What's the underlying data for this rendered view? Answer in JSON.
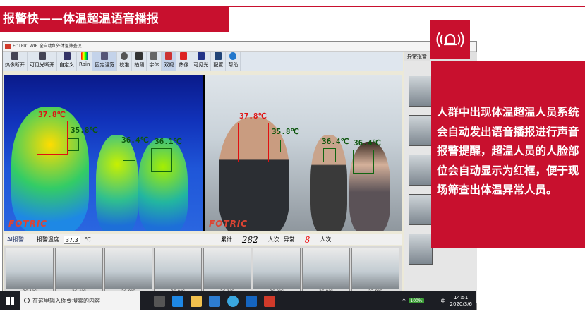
{
  "slide": {
    "title": "报警快——体温超温语音播报",
    "description": "人群中出现体温超温人员系统会自动发出语音播报进行声音报警提醒，超温人员的人脸部位会自动显示为红框，便于现场筛查出体温异常人员。",
    "accent_color": "#c8102e",
    "icon": "alarm-bell-icon"
  },
  "app": {
    "window_title": "FOTRIC WIR 全自动红外体温筛查仪",
    "toolbar": [
      {
        "label": "热像断开",
        "icon": "thermal-disconnect-icon"
      },
      {
        "label": "可见光断开",
        "icon": "visible-disconnect-icon"
      },
      {
        "label": "自定义",
        "icon": "anchor-icon"
      },
      {
        "label": "Rain",
        "icon": "palette-icon"
      },
      {
        "label": "固定温宽",
        "icon": "fixed-span-icon"
      },
      {
        "label": "校准",
        "icon": "gear-icon"
      },
      {
        "label": "拍照",
        "icon": "camera-icon"
      },
      {
        "label": "字体",
        "icon": "font-icon"
      },
      {
        "label": "双视",
        "icon": "dual-view-icon"
      },
      {
        "label": "热像",
        "icon": "thermal-icon"
      },
      {
        "label": "可见光",
        "icon": "visible-icon"
      },
      {
        "label": "配置",
        "icon": "monitor-icon"
      },
      {
        "label": "帮助",
        "icon": "help-icon"
      }
    ],
    "side_panel_title": "异常报警",
    "thermal_brand": "FOTRIC",
    "visible_brand": "FOTRIC",
    "thermal_readings": [
      "37.8℃",
      "35.8℃",
      "36.4℃",
      "36.1℃"
    ],
    "visible_readings": [
      "37.8℃",
      "35.8℃",
      "36.4℃",
      "36.4℃"
    ],
    "status": {
      "ai_label": "AI报警",
      "alarm_temp_label": "报警温度",
      "alarm_temp_value": "37.3",
      "alarm_temp_unit": "℃",
      "total_label": "累计",
      "total_value": "282",
      "total_unit": "人次",
      "abnormal_label": "异常",
      "abnormal_value": "8",
      "abnormal_unit": "人次"
    },
    "thumb_temps": [
      "36.1℃",
      "36.4℃",
      "36.0℃",
      "36.0℃",
      "36.1℃",
      "36.2℃",
      "36.0℃",
      "37.8℃"
    ]
  },
  "taskbar": {
    "search_placeholder": "在这里输入你要搜索的内容",
    "battery": "100%",
    "ime": "中",
    "time": "14:51",
    "date": "2020/3/6"
  }
}
